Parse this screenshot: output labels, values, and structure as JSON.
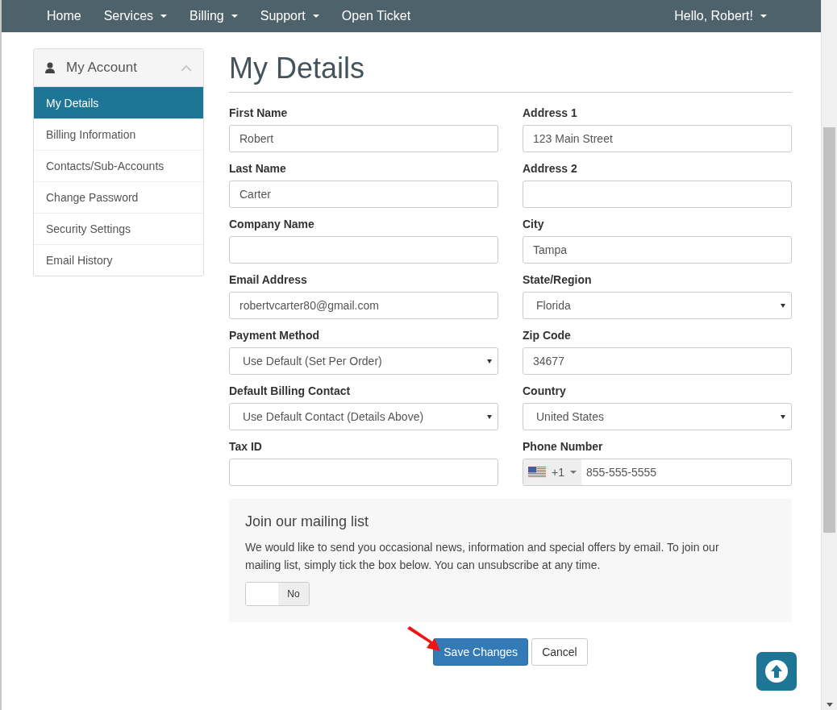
{
  "nav": {
    "items": [
      {
        "label": "Home",
        "dropdown": false
      },
      {
        "label": "Services",
        "dropdown": true
      },
      {
        "label": "Billing",
        "dropdown": true
      },
      {
        "label": "Support",
        "dropdown": true
      },
      {
        "label": "Open Ticket",
        "dropdown": false
      }
    ],
    "user_menu": {
      "label": "Hello, Robert!",
      "dropdown": true
    }
  },
  "sidebar": {
    "title": "My Account",
    "expanded": true,
    "items": [
      {
        "label": "My Details",
        "selected": true
      },
      {
        "label": "Billing Information",
        "selected": false
      },
      {
        "label": "Contacts/Sub-Accounts",
        "selected": false
      },
      {
        "label": "Change Password",
        "selected": false
      },
      {
        "label": "Security Settings",
        "selected": false
      },
      {
        "label": "Email History",
        "selected": false
      }
    ]
  },
  "page_title": "My Details",
  "fields": [
    {
      "kind": "text",
      "label": "First Name",
      "value": "Robert"
    },
    {
      "kind": "text",
      "label": "Address 1",
      "value": "123 Main Street"
    },
    {
      "kind": "text",
      "label": "Last Name",
      "value": "Carter"
    },
    {
      "kind": "text",
      "label": "Address 2"
    },
    {
      "kind": "text",
      "label": "Company Name"
    },
    {
      "kind": "text",
      "label": "City",
      "value": "Tampa"
    },
    {
      "kind": "text",
      "label": "Email Address",
      "value": "robertvcarter80@gmail.com"
    },
    {
      "kind": "select",
      "label": "State/Region",
      "value": "Florida"
    },
    {
      "kind": "select",
      "label": "Payment Method",
      "value": "Use Default (Set Per Order)"
    },
    {
      "kind": "text",
      "label": "Zip Code",
      "value": "34677"
    },
    {
      "kind": "select",
      "label": "Default Billing Contact",
      "value": "Use Default Contact (Details Above)"
    },
    {
      "kind": "select",
      "label": "Country",
      "value": "United States"
    },
    {
      "kind": "text",
      "label": "Tax ID"
    },
    {
      "kind": "phone",
      "label": "Phone Number",
      "dial_code": "+1",
      "value": "855-555-5555"
    }
  ],
  "mailing_list": {
    "title": "Join our mailing list",
    "text": "We would like to send you occasional news, information and special offers by email. To join our mailing list, simply tick the box below. You can unsubscribe at any time.",
    "toggle": {
      "on": false,
      "label": "No"
    }
  },
  "buttons": [
    {
      "kind": "primary",
      "label": "Save Changes"
    },
    {
      "kind": "default",
      "label": "Cancel"
    }
  ]
}
